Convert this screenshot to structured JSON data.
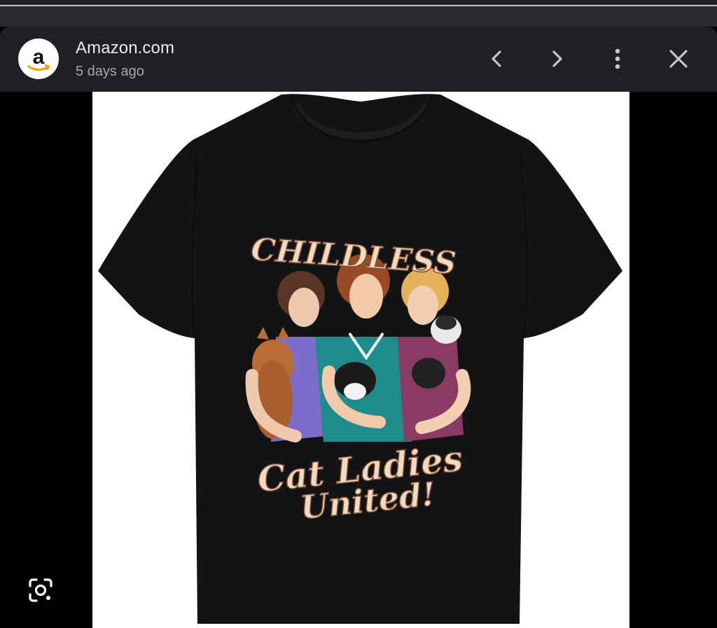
{
  "header": {
    "site_name": "Amazon.com",
    "timestamp": "5 days ago",
    "favicon_icon": "amazon-logo-icon",
    "actions": [
      {
        "name": "previous-image-button",
        "icon": "chevron-left-icon"
      },
      {
        "name": "next-image-button",
        "icon": "chevron-right-icon"
      },
      {
        "name": "more-options-button",
        "icon": "more-vert-icon"
      },
      {
        "name": "close-button",
        "icon": "close-icon"
      }
    ]
  },
  "image": {
    "subject": "black t-shirt with retro cat ladies graphic",
    "print_line1": "CHILDLESS",
    "print_line2": "Cat Ladies",
    "print_line3": "United!",
    "shirt_color": "#121314"
  },
  "viewer": {
    "lens_icon": "google-lens-icon"
  },
  "colors": {
    "header_bg": "#1f2023",
    "text_primary": "#e8eaed",
    "text_secondary": "#a6a8ab",
    "icon": "#c4c7c5",
    "amazon_orange": "#ff9900",
    "print_cream": "#f3d9bf"
  }
}
